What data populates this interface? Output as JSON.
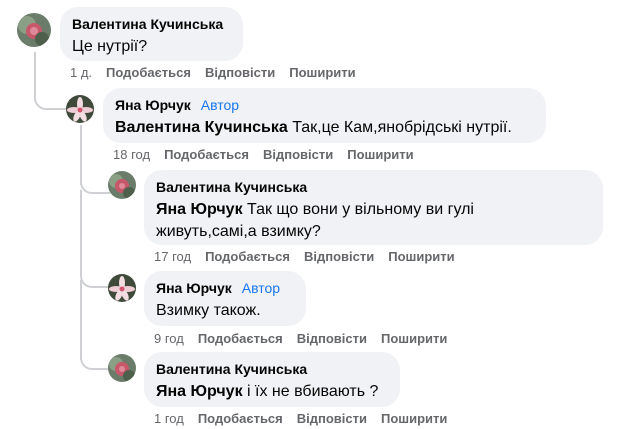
{
  "comments": [
    {
      "author": "Валентина Кучинська",
      "badge": "",
      "mention": "",
      "text": "Це нутрії?",
      "time": "1 д.",
      "avatar_icon": "rose-avatar-icon"
    },
    {
      "author": "Яна Юрчук",
      "badge": "Автор",
      "mention": "Валентина Кучинська",
      "text": "Так,це Кам,янобрідські нутрії.",
      "time": "18 год",
      "avatar_icon": "lily-avatar-icon"
    },
    {
      "author": "Валентина Кучинська",
      "badge": "",
      "mention": "Яна Юрчук",
      "text_line1": "Так що вони у вільному ви гулі",
      "text_line2": "живуть,самі,а взимку?",
      "time": "17 год",
      "avatar_icon": "rose-avatar-icon"
    },
    {
      "author": "Яна Юрчук",
      "badge": "Автор",
      "mention": "",
      "text": "Взимку також.",
      "time": "9 год",
      "avatar_icon": "lily-avatar-icon"
    },
    {
      "author": "Валентина Кучинська",
      "badge": "",
      "mention": "Яна Юрчук",
      "text": "і їх не вбивають ?",
      "time": "1 год",
      "avatar_icon": "rose-avatar-icon"
    }
  ],
  "actions": {
    "like": "Подобається",
    "reply": "Відповісти",
    "share": "Поширити"
  },
  "colors": {
    "bubble": "#f0f2f5",
    "author_badge": "#1877f2",
    "meta": "#65676b",
    "thread_line": "#ced0d4"
  }
}
